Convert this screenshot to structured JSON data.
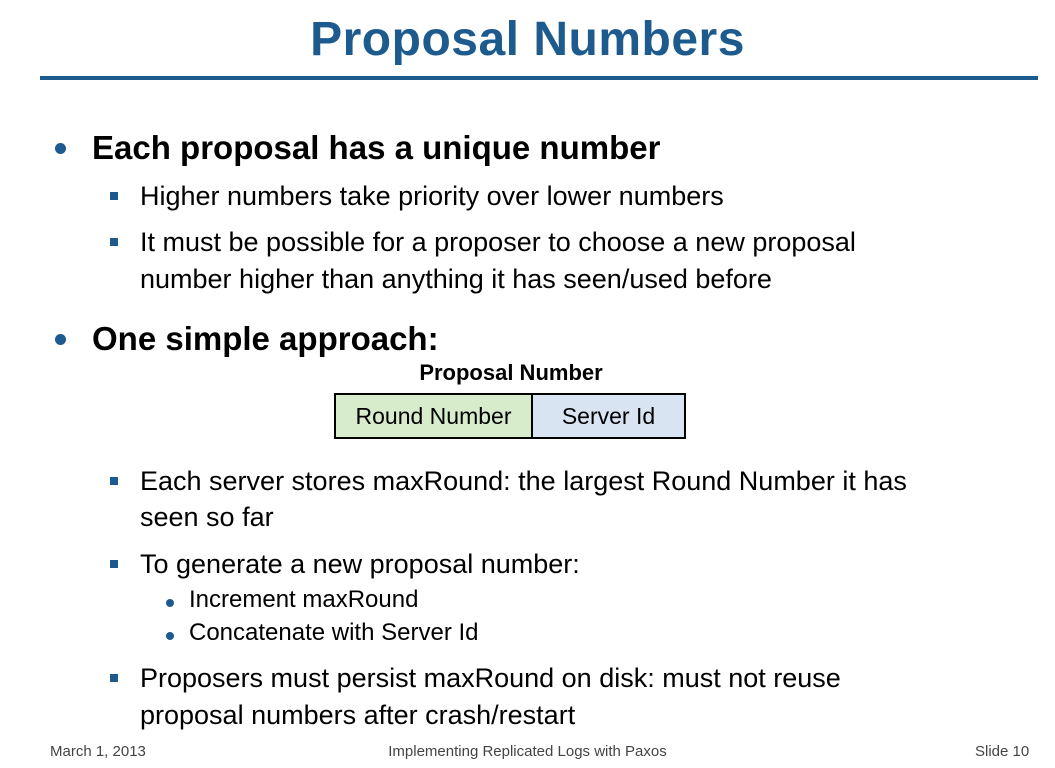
{
  "title": "Proposal Numbers",
  "bullets": {
    "b1": "Each proposal has a unique number",
    "b1_sub1": "Higher numbers take priority over lower numbers",
    "b1_sub2_line1": "It must be possible for a proposer to choose a new proposal",
    "b1_sub2_line2": "number higher than anything it has seen/used before",
    "b2": "One simple approach:",
    "b2_sub1_line1": "Each server stores maxRound: the largest Round Number it has",
    "b2_sub1_line2": "seen so far",
    "b2_sub2": "To generate a new proposal number:",
    "b2_sub2_item1": "Increment maxRound",
    "b2_sub2_item2": "Concatenate with Server Id",
    "b2_sub3_line1": "Proposers must persist maxRound on disk: must not reuse",
    "b2_sub3_line2": "proposal numbers after crash/restart"
  },
  "diagram": {
    "label": "Proposal Number",
    "left_cell": "Round Number",
    "right_cell": "Server Id",
    "left_color": "#d7eccb",
    "right_color": "#d9e4f2"
  },
  "footer": {
    "date": "March 1, 2013",
    "center": "Implementing Replicated Logs with Paxos",
    "slide": "Slide 10"
  },
  "colors": {
    "accent": "#1d5a8e"
  }
}
